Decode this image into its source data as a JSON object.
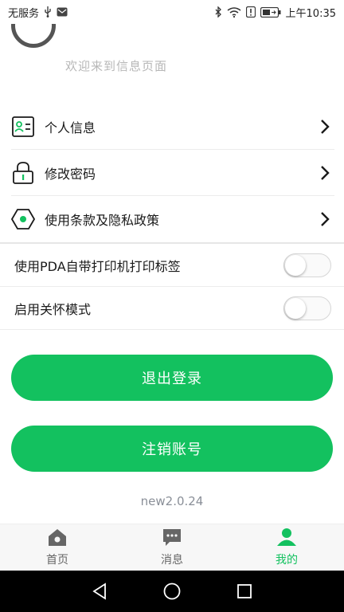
{
  "status_bar": {
    "carrier": "无服务",
    "time": "上午10:35",
    "icons": [
      "usb-icon",
      "mail-icon",
      "bluetooth-icon",
      "wifi-icon",
      "alert-icon",
      "battery-icon"
    ]
  },
  "header": {
    "welcome": "欢迎来到信息页面"
  },
  "menu": {
    "items": [
      {
        "label": "个人信息",
        "icon": "id-card-icon"
      },
      {
        "label": "修改密码",
        "icon": "lock-icon"
      },
      {
        "label": "使用条款及隐私政策",
        "icon": "policy-icon"
      }
    ]
  },
  "settings": {
    "items": [
      {
        "label": "使用PDA自带打印机打印标签",
        "enabled": false
      },
      {
        "label": "启用关怀模式",
        "enabled": false
      }
    ]
  },
  "actions": {
    "logout": "退出登录",
    "cancel_account": "注销账号"
  },
  "version": "new2.0.24",
  "bottom_nav": {
    "items": [
      {
        "label": "首页",
        "icon": "home-icon",
        "active": false
      },
      {
        "label": "消息",
        "icon": "message-icon",
        "active": false
      },
      {
        "label": "我的",
        "icon": "profile-icon",
        "active": true
      }
    ]
  },
  "colors": {
    "accent": "#13c15f",
    "text": "#1a1a1a",
    "muted": "#8a8f98"
  }
}
